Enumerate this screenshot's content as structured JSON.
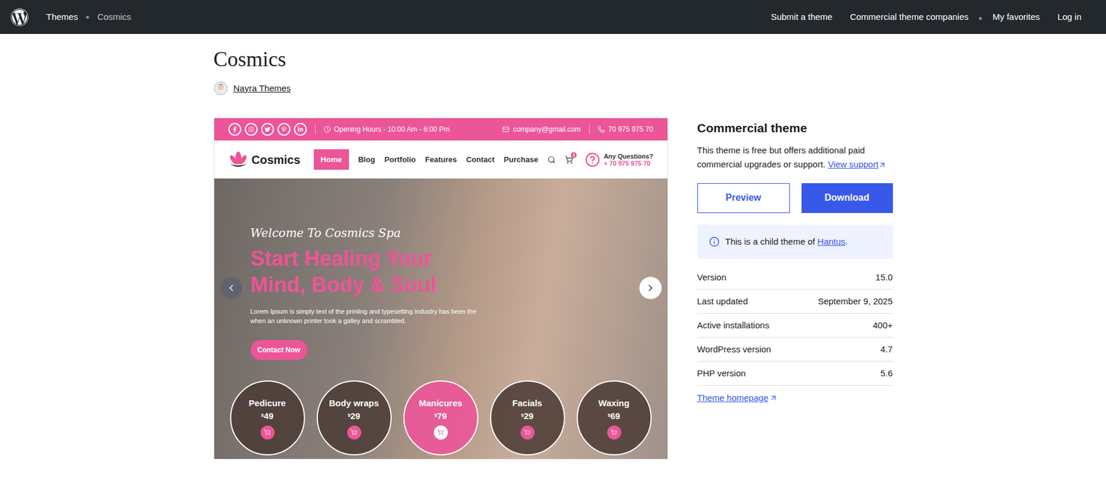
{
  "topbar": {
    "breadcrumb": [
      "Themes",
      "Cosmics"
    ],
    "links": [
      "Submit a theme",
      "Commercial theme companies",
      "My favorites",
      "Log in"
    ]
  },
  "theme": {
    "title": "Cosmics",
    "author": "Nayra Themes"
  },
  "preview": {
    "topbar": {
      "hours": "Opening Hours - 10:00 Am - 6:00 Pm",
      "email": "company@gmail.com",
      "phone": "70 975 975 70"
    },
    "header": {
      "logo": "Cosmics",
      "nav": [
        {
          "label": "Home",
          "selected": true
        },
        {
          "label": "Blog",
          "selected": false
        },
        {
          "label": "Portfolio",
          "selected": false
        },
        {
          "label": "Features",
          "selected": false
        },
        {
          "label": "Contact",
          "selected": false
        },
        {
          "label": "Purchase",
          "selected": false
        }
      ],
      "cart_count": "1",
      "question": "Any Questions?",
      "phone": "+ 70 975 975 70"
    },
    "hero": {
      "script": "Welcome To Cosmics Spa",
      "headline": [
        "Start Healing Your",
        "Mind, Body & Soul"
      ],
      "body": "Lorem Ipsum is simply text of the printing and typesetting industry has been the when an unknown printer took a galley and scrambled.",
      "cta": "Contact Now"
    },
    "services": [
      {
        "name": "Pedicure",
        "currency": "$",
        "price": "49",
        "selected": false
      },
      {
        "name": "Body wraps",
        "currency": "$",
        "price": "29",
        "selected": false
      },
      {
        "name": "Manicures",
        "currency": "$",
        "price": "79",
        "selected": true
      },
      {
        "name": "Facials",
        "currency": "$",
        "price": "29",
        "selected": false
      },
      {
        "name": "Waxing",
        "currency": "$",
        "price": "69",
        "selected": false
      }
    ]
  },
  "sidebar": {
    "heading": "Commercial theme",
    "description": "This theme is free but offers additional paid commercial upgrades or support.",
    "support_link": "View support",
    "buttons": [
      "Preview",
      "Download"
    ],
    "notice": {
      "text": "This is a child theme of ",
      "link": "Hantus",
      "suffix": "."
    },
    "meta": [
      {
        "label": "Version",
        "value": "15.0"
      },
      {
        "label": "Last updated",
        "value": "September 9, 2025"
      },
      {
        "label": "Active installations",
        "value": "400+"
      },
      {
        "label": "WordPress version",
        "value": "4.7"
      },
      {
        "label": "PHP version",
        "value": "5.6"
      }
    ],
    "homepage": "Theme homepage"
  }
}
